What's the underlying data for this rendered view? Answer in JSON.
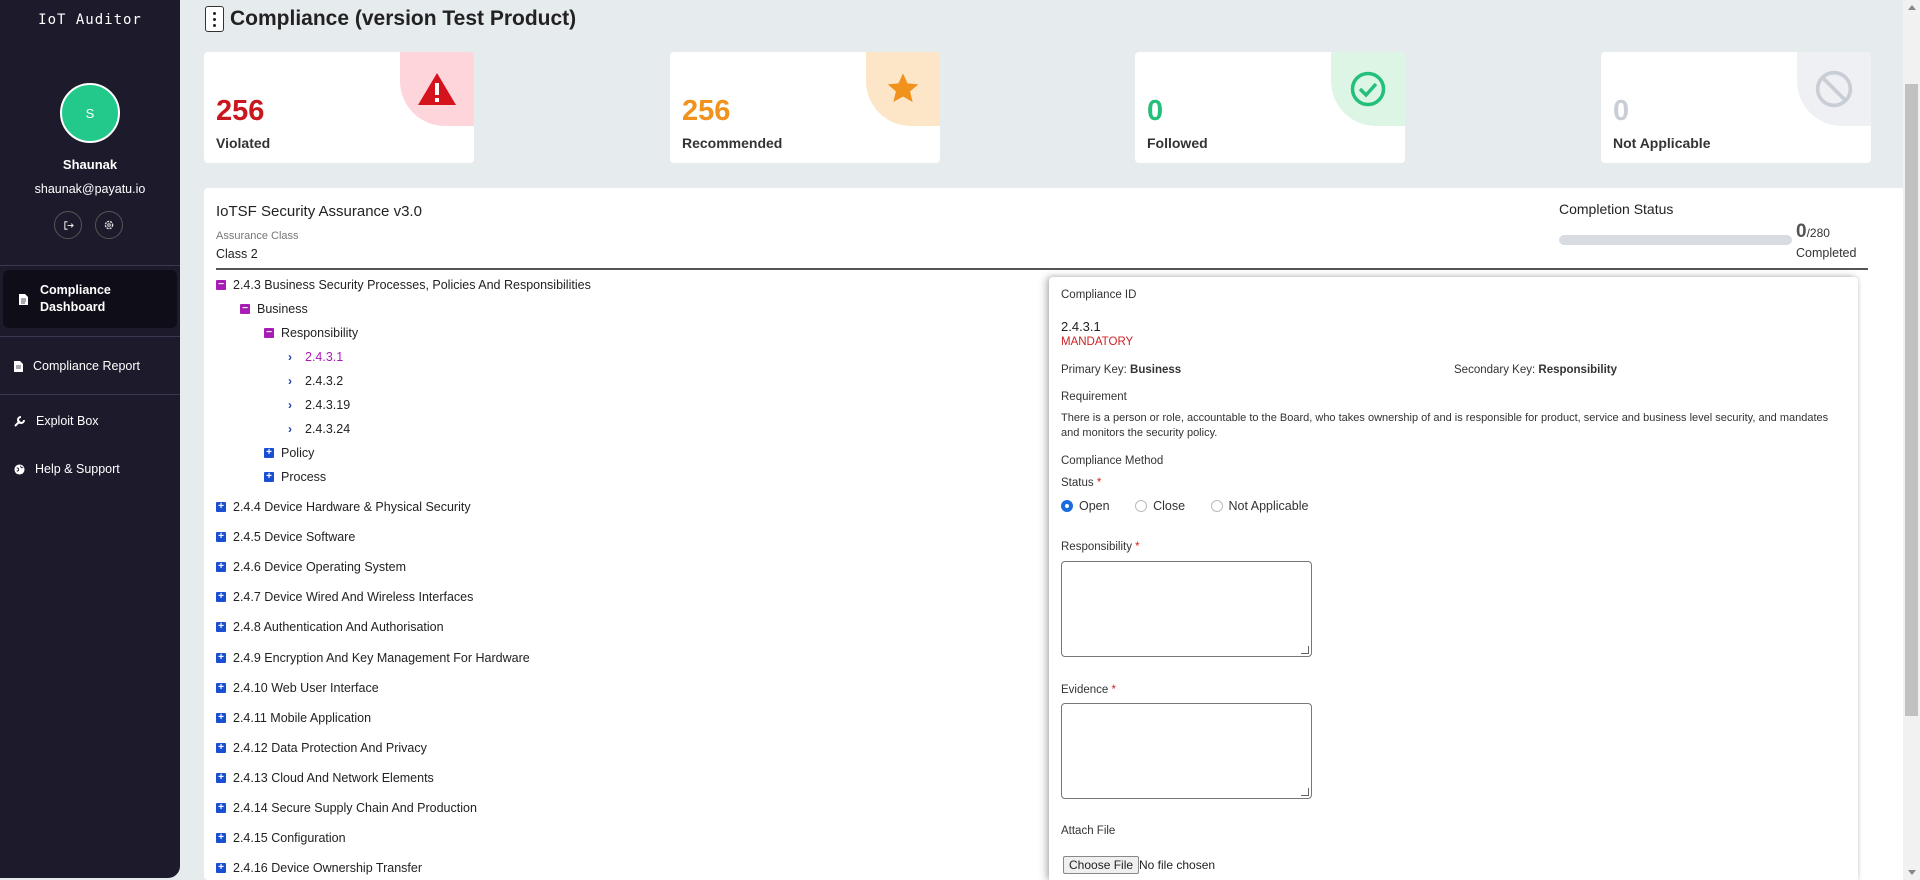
{
  "app": {
    "brand": "IoT Auditor"
  },
  "user": {
    "initial": "S",
    "name": "Shaunak",
    "email": "shaunak@payatu.io"
  },
  "nav": {
    "active": "Compliance Dashboard",
    "items": [
      "Compliance Report",
      "Exploit Box",
      "Help & Support"
    ]
  },
  "header": {
    "title": "Compliance (version Test Product)"
  },
  "stats": [
    {
      "value": "256",
      "label": "Violated",
      "color": "#c8171e",
      "bg": "#fdd5db",
      "icon": "warning-icon"
    },
    {
      "value": "256",
      "label": "Recommended",
      "color": "#f0921c",
      "bg": "#fde6c8",
      "icon": "star-icon"
    },
    {
      "value": "0",
      "label": "Followed",
      "color": "#22c07a",
      "bg": "#dcf5e4",
      "icon": "check-circle-icon"
    },
    {
      "value": "0",
      "label": "Not Applicable",
      "color": "#c9ced6",
      "bg": "#eef0f3",
      "icon": "ban-icon"
    }
  ],
  "framework": {
    "title": "IoTSF Security Assurance v3.0",
    "assurance_class_label": "Assurance Class",
    "assurance_class": "Class 2"
  },
  "completion": {
    "label": "Completion Status",
    "done": "0",
    "total": "/280",
    "caption": "Completed",
    "progress": 0
  },
  "tree": {
    "open_section": "2.4.3 Business Security Processes, Policies And Responsibilities",
    "business": "Business",
    "responsibility": "Responsibility",
    "ids": [
      "2.4.3.1",
      "2.4.3.2",
      "2.4.3.19",
      "2.4.3.24"
    ],
    "policy": "Policy",
    "process": "Process",
    "sections": [
      "2.4.4 Device Hardware & Physical Security",
      "2.4.5 Device Software",
      "2.4.6 Device Operating System",
      "2.4.7 Device Wired And Wireless Interfaces",
      "2.4.8 Authentication And Authorisation",
      "2.4.9 Encryption And Key Management For Hardware",
      "2.4.10 Web User Interface",
      "2.4.11 Mobile Application",
      "2.4.12 Data Protection And Privacy",
      "2.4.13 Cloud And Network Elements",
      "2.4.14 Secure Supply Chain And Production",
      "2.4.15 Configuration",
      "2.4.16 Device Ownership Transfer"
    ]
  },
  "detail": {
    "id_label": "Compliance ID",
    "id": "2.4.3.1",
    "level": "MANDATORY",
    "primary_key_label": "Primary Key:",
    "primary_key": "Business",
    "secondary_key_label": "Secondary Key:",
    "secondary_key": "Responsibility",
    "requirement_label": "Requirement",
    "requirement": "There is a person or role, accountable to the Board, who takes ownership of and is responsible for product, service and business level security, and mandates and monitors the security policy.",
    "method_label": "Compliance Method",
    "status_label": "Status",
    "status_options": [
      "Open",
      "Close",
      "Not Applicable"
    ],
    "responsibility_label": "Responsibility",
    "evidence_label": "Evidence",
    "attach_label": "Attach File",
    "file_button": "Choose File",
    "file_status": "No file chosen",
    "required_mark": "*"
  }
}
